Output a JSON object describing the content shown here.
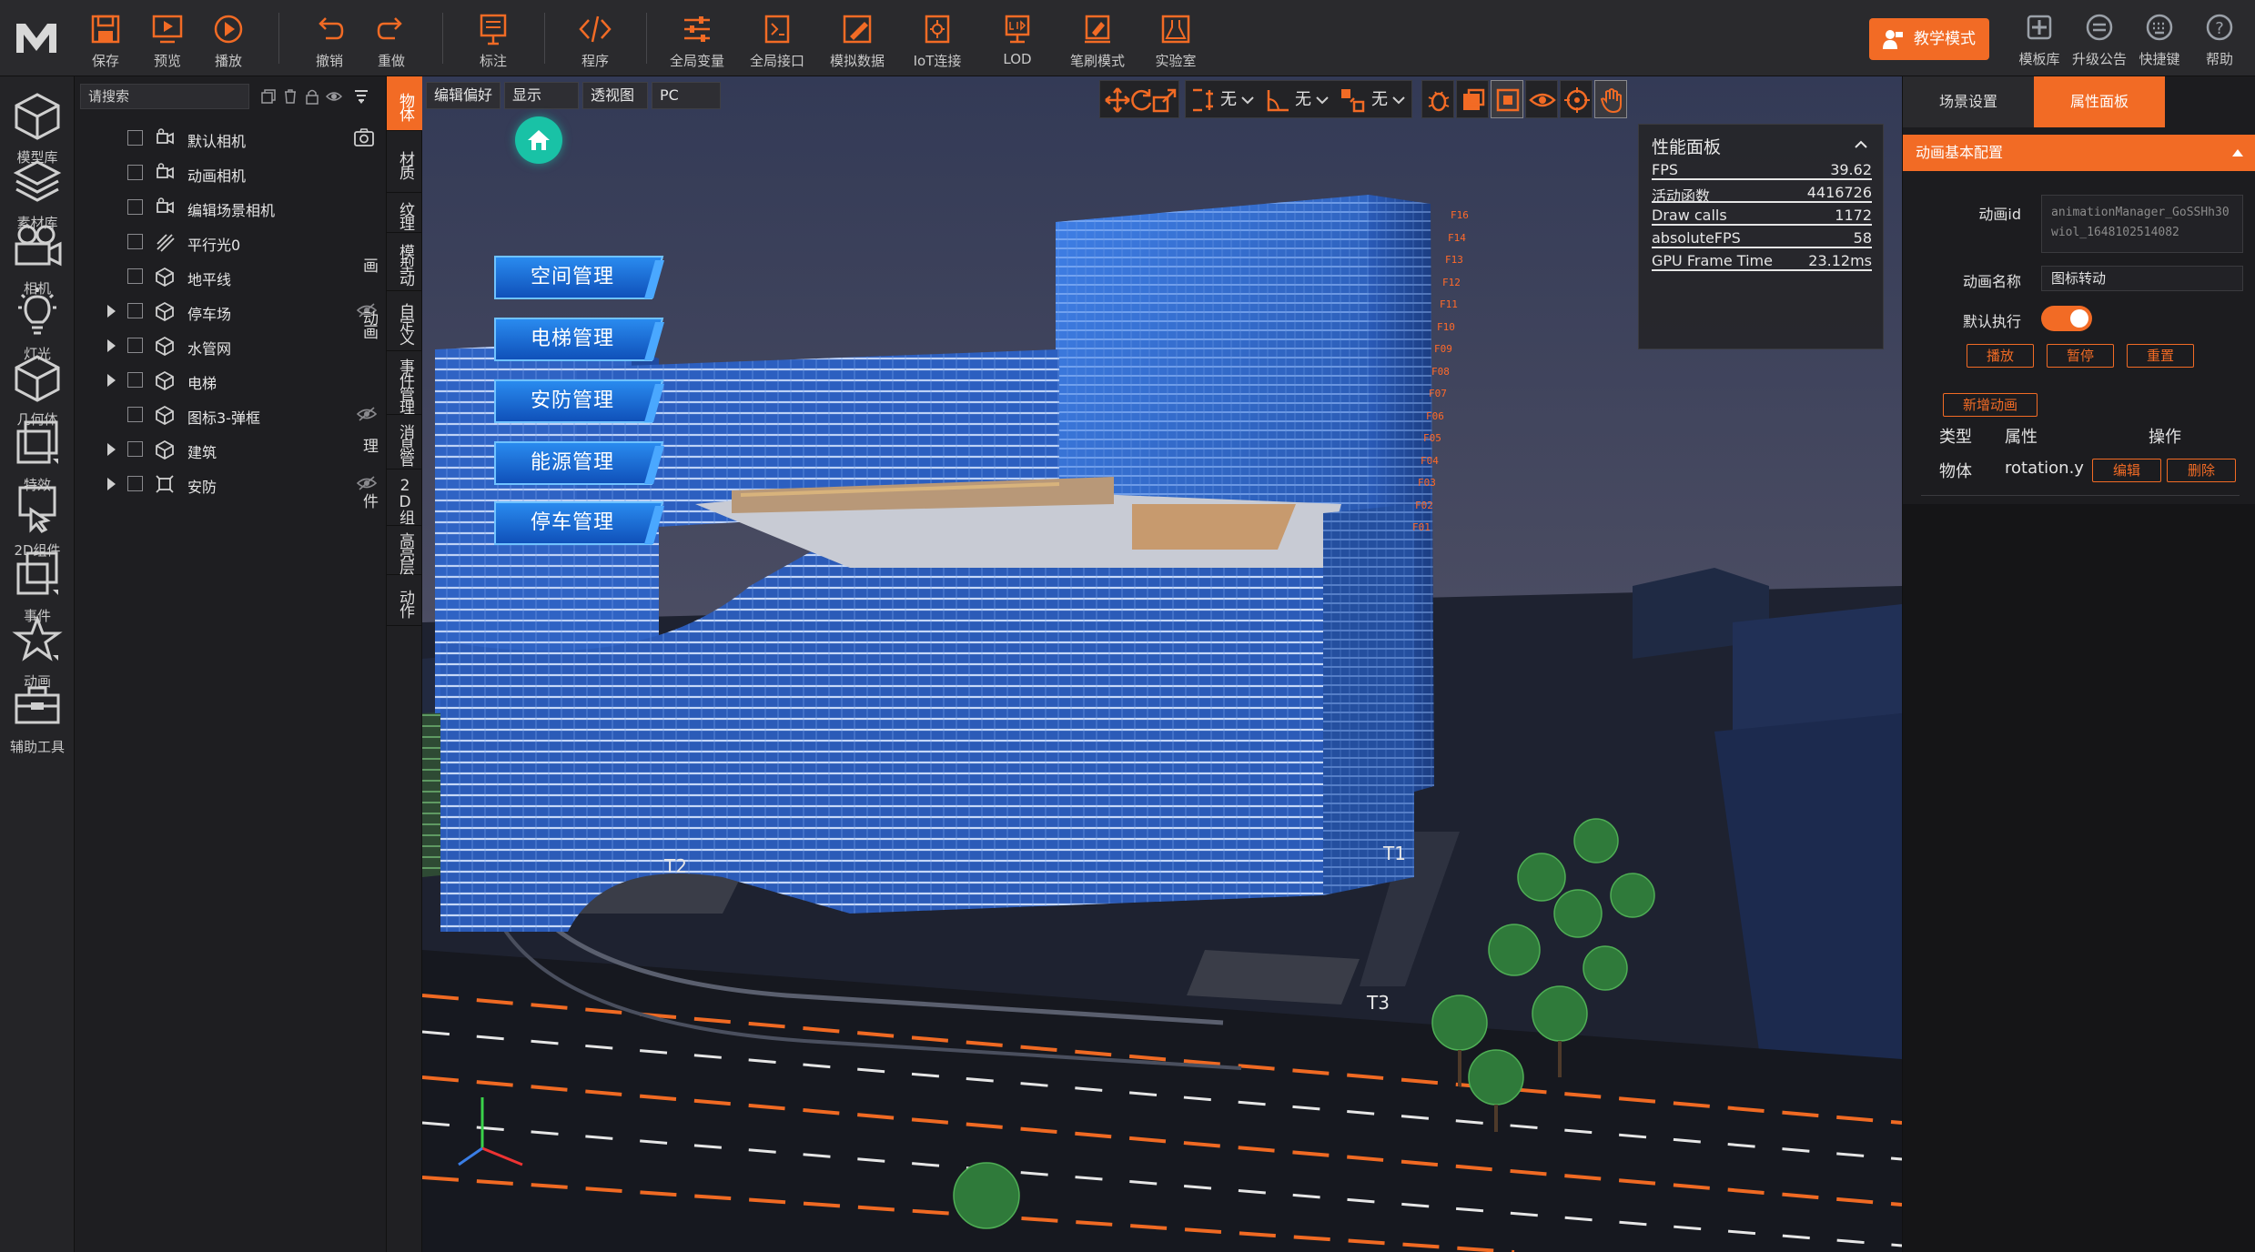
{
  "toolbar": {
    "items": [
      {
        "label": "保存",
        "icon": "save-icon"
      },
      {
        "label": "预览",
        "icon": "preview-icon"
      },
      {
        "label": "播放",
        "icon": "play-icon"
      },
      {
        "label": "撤销",
        "icon": "undo-icon"
      },
      {
        "label": "重做",
        "icon": "redo-icon"
      },
      {
        "label": "标注",
        "icon": "annotation-icon"
      },
      {
        "label": "程序",
        "icon": "code-icon"
      },
      {
        "label": "全局变量",
        "icon": "sliders-icon"
      },
      {
        "label": "全局接口",
        "icon": "api-icon"
      },
      {
        "label": "模拟数据",
        "icon": "mock-data-icon"
      },
      {
        "label": "IoT连接",
        "icon": "iot-icon"
      },
      {
        "label": "LOD",
        "icon": "lod-icon"
      },
      {
        "label": "笔刷模式",
        "icon": "brush-icon"
      },
      {
        "label": "实验室",
        "icon": "lab-icon"
      }
    ],
    "teach_mode": "教学模式",
    "right_items": [
      {
        "label": "模板库",
        "icon": "template-icon"
      },
      {
        "label": "升级公告",
        "icon": "announcement-icon"
      },
      {
        "label": "快捷键",
        "icon": "keyboard-icon"
      },
      {
        "label": "帮助",
        "icon": "help-icon"
      }
    ]
  },
  "leftbar": {
    "items": [
      {
        "label": "模型库",
        "icon": "cube-icon"
      },
      {
        "label": "素材库",
        "icon": "layers-icon"
      },
      {
        "label": "相机",
        "icon": "camera-icon"
      },
      {
        "label": "灯光",
        "icon": "bulb-icon"
      },
      {
        "label": "几何体",
        "icon": "geometry-icon"
      },
      {
        "label": "特效",
        "icon": "effect-icon"
      },
      {
        "label": "2D组件",
        "icon": "component-2d-icon"
      },
      {
        "label": "事件",
        "icon": "event-icon"
      },
      {
        "label": "动画",
        "icon": "star-icon"
      },
      {
        "label": "辅助工具",
        "icon": "toolbox-icon"
      }
    ]
  },
  "tree": {
    "search_placeholder": "请搜索",
    "items": [
      {
        "label": "默认相机",
        "icon": "camera-icon",
        "expandable": false
      },
      {
        "label": "动画相机",
        "icon": "camera-icon",
        "expandable": false
      },
      {
        "label": "编辑场景相机",
        "icon": "camera-icon",
        "expandable": false
      },
      {
        "label": "平行光0",
        "icon": "light-icon",
        "expandable": false
      },
      {
        "label": "地平线",
        "icon": "cube-icon",
        "expandable": false
      },
      {
        "label": "停车场",
        "icon": "cube-icon",
        "expandable": true
      },
      {
        "label": "水管网",
        "icon": "cube-icon",
        "expandable": true
      },
      {
        "label": "电梯",
        "icon": "cube-icon",
        "expandable": true
      },
      {
        "label": "图标3-弹框",
        "icon": "cube-icon",
        "expandable": false
      },
      {
        "label": "建筑",
        "icon": "cube-icon",
        "expandable": true
      },
      {
        "label": "安防",
        "icon": "security-icon",
        "expandable": true
      }
    ]
  },
  "vtabs": [
    "物体",
    "材质",
    "纹理",
    "模型动画",
    "自定义动画",
    "事件管理",
    "消息管理",
    "2D组件",
    "高亮层",
    "动作"
  ],
  "viewport": {
    "chips": [
      "编辑偏好",
      "显示",
      "透视图",
      "PC"
    ],
    "snap_options": [
      "无",
      "无",
      "无"
    ],
    "menu_buttons": [
      "空间管理",
      "电梯管理",
      "安防管理",
      "能源管理",
      "停车管理"
    ],
    "floor_labels": [
      "F16",
      "F14",
      "F13",
      "F12",
      "F11",
      "F10",
      "F09",
      "F08",
      "F07",
      "F06",
      "F05",
      "F04",
      "F03",
      "F02",
      "F01"
    ],
    "tower_labels": [
      "T1",
      "T2",
      "T3"
    ]
  },
  "perf": {
    "title": "性能面板",
    "rows": [
      {
        "key": "FPS",
        "value": "39.62"
      },
      {
        "key": "活动函数",
        "value": "4416726"
      },
      {
        "key": "Draw calls",
        "value": "1172"
      },
      {
        "key": "absoluteFPS",
        "value": "58"
      },
      {
        "key": "GPU Frame Time",
        "value": "23.12ms"
      }
    ]
  },
  "rpanel": {
    "tabs": [
      "场景设置",
      "属性面板"
    ],
    "section": "动画基本配置",
    "anim_id_label": "动画id",
    "anim_id_value": "animationManager_GoSSHh30wiol_1648102514082",
    "anim_name_label": "动画名称",
    "anim_name_value": "图标转动",
    "default_run_label": "默认执行",
    "buttons": [
      "播放",
      "暂停",
      "重置"
    ],
    "add_anim": "新增动画",
    "table_headers": [
      "类型",
      "属性",
      "操作"
    ],
    "row": {
      "type": "物体",
      "prop": "rotation.y",
      "edit": "编辑",
      "delete": "删除"
    }
  },
  "colors": {
    "accent": "#f26b25",
    "teal": "#19c2a6",
    "building": "#2f6fd6"
  }
}
